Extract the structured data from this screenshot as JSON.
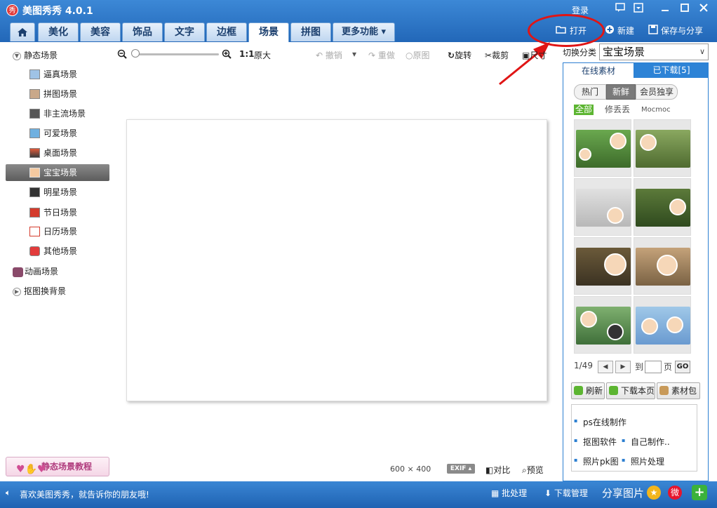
{
  "titlebar": {
    "logo_text": "秀",
    "title": "美图秀秀 4.0.1",
    "login": "登录",
    "window_buttons": [
      "feedback-icon",
      "menu-icon",
      "minimize-icon",
      "maximize-icon",
      "close-icon"
    ]
  },
  "tabs": [
    {
      "label": "美化"
    },
    {
      "label": "美容"
    },
    {
      "label": "饰品"
    },
    {
      "label": "文字"
    },
    {
      "label": "边框"
    },
    {
      "label": "场景",
      "active": true
    },
    {
      "label": "拼图"
    },
    {
      "label": "更多功能 ▾"
    }
  ],
  "top_toolbar": {
    "open": "打开",
    "new": "新建",
    "save_share": "保存与分享"
  },
  "sidebar": {
    "static_group": "静态场景",
    "items": [
      {
        "label": "逼真场景"
      },
      {
        "label": "拼图场景"
      },
      {
        "label": "非主流场景"
      },
      {
        "label": "可爱场景"
      },
      {
        "label": "桌面场景"
      },
      {
        "label": "宝宝场景",
        "selected": true
      },
      {
        "label": "明星场景"
      },
      {
        "label": "节日场景"
      },
      {
        "label": "日历场景"
      },
      {
        "label": "其他场景"
      }
    ],
    "animated_group": "动画场景",
    "cutout_group": "抠图换背景",
    "tutorial_button": "静态场景教程"
  },
  "canvas_toolbar": {
    "ratio": "1:1",
    "original_size": "原大",
    "undo": "撤销",
    "redo": "重做",
    "original": "原图",
    "rotate": "旋转",
    "crop": "裁剪",
    "resize": "尺寸"
  },
  "canvas": {
    "width_text": "600",
    "times": "×",
    "height_text": "400",
    "exif": "EXIF",
    "compare": "对比",
    "preview": "预览"
  },
  "right_panel": {
    "switch_label": "切换分类",
    "category": "宝宝场景",
    "tab_online": "在线素材",
    "tab_downloaded": "已下载[5]",
    "subtabs": [
      "热门",
      "新鲜",
      "会员独享"
    ],
    "filters": [
      "全部",
      "修丢丢",
      "Mocmoc"
    ],
    "pager": {
      "current": "1/49",
      "go_to": "到",
      "page": "页",
      "go": "GO"
    },
    "buttons": {
      "refresh": "刷新",
      "download_page": "下载本页",
      "pack": "素材包"
    },
    "links": [
      "ps在线制作",
      "抠图软件",
      "自己制作..",
      "照片pk图",
      "照片处理"
    ]
  },
  "statusbar": {
    "message": "喜欢美图秀秀，就告诉你的朋友哦!",
    "batch": "批处理",
    "download_manager": "下载管理",
    "share_image": "分享图片"
  },
  "colors": {
    "titlebar_blue": "#2a72c4",
    "highlight_red": "#e01515",
    "selected_gray": "#6e6e6e",
    "filter_green": "#5cb531"
  }
}
